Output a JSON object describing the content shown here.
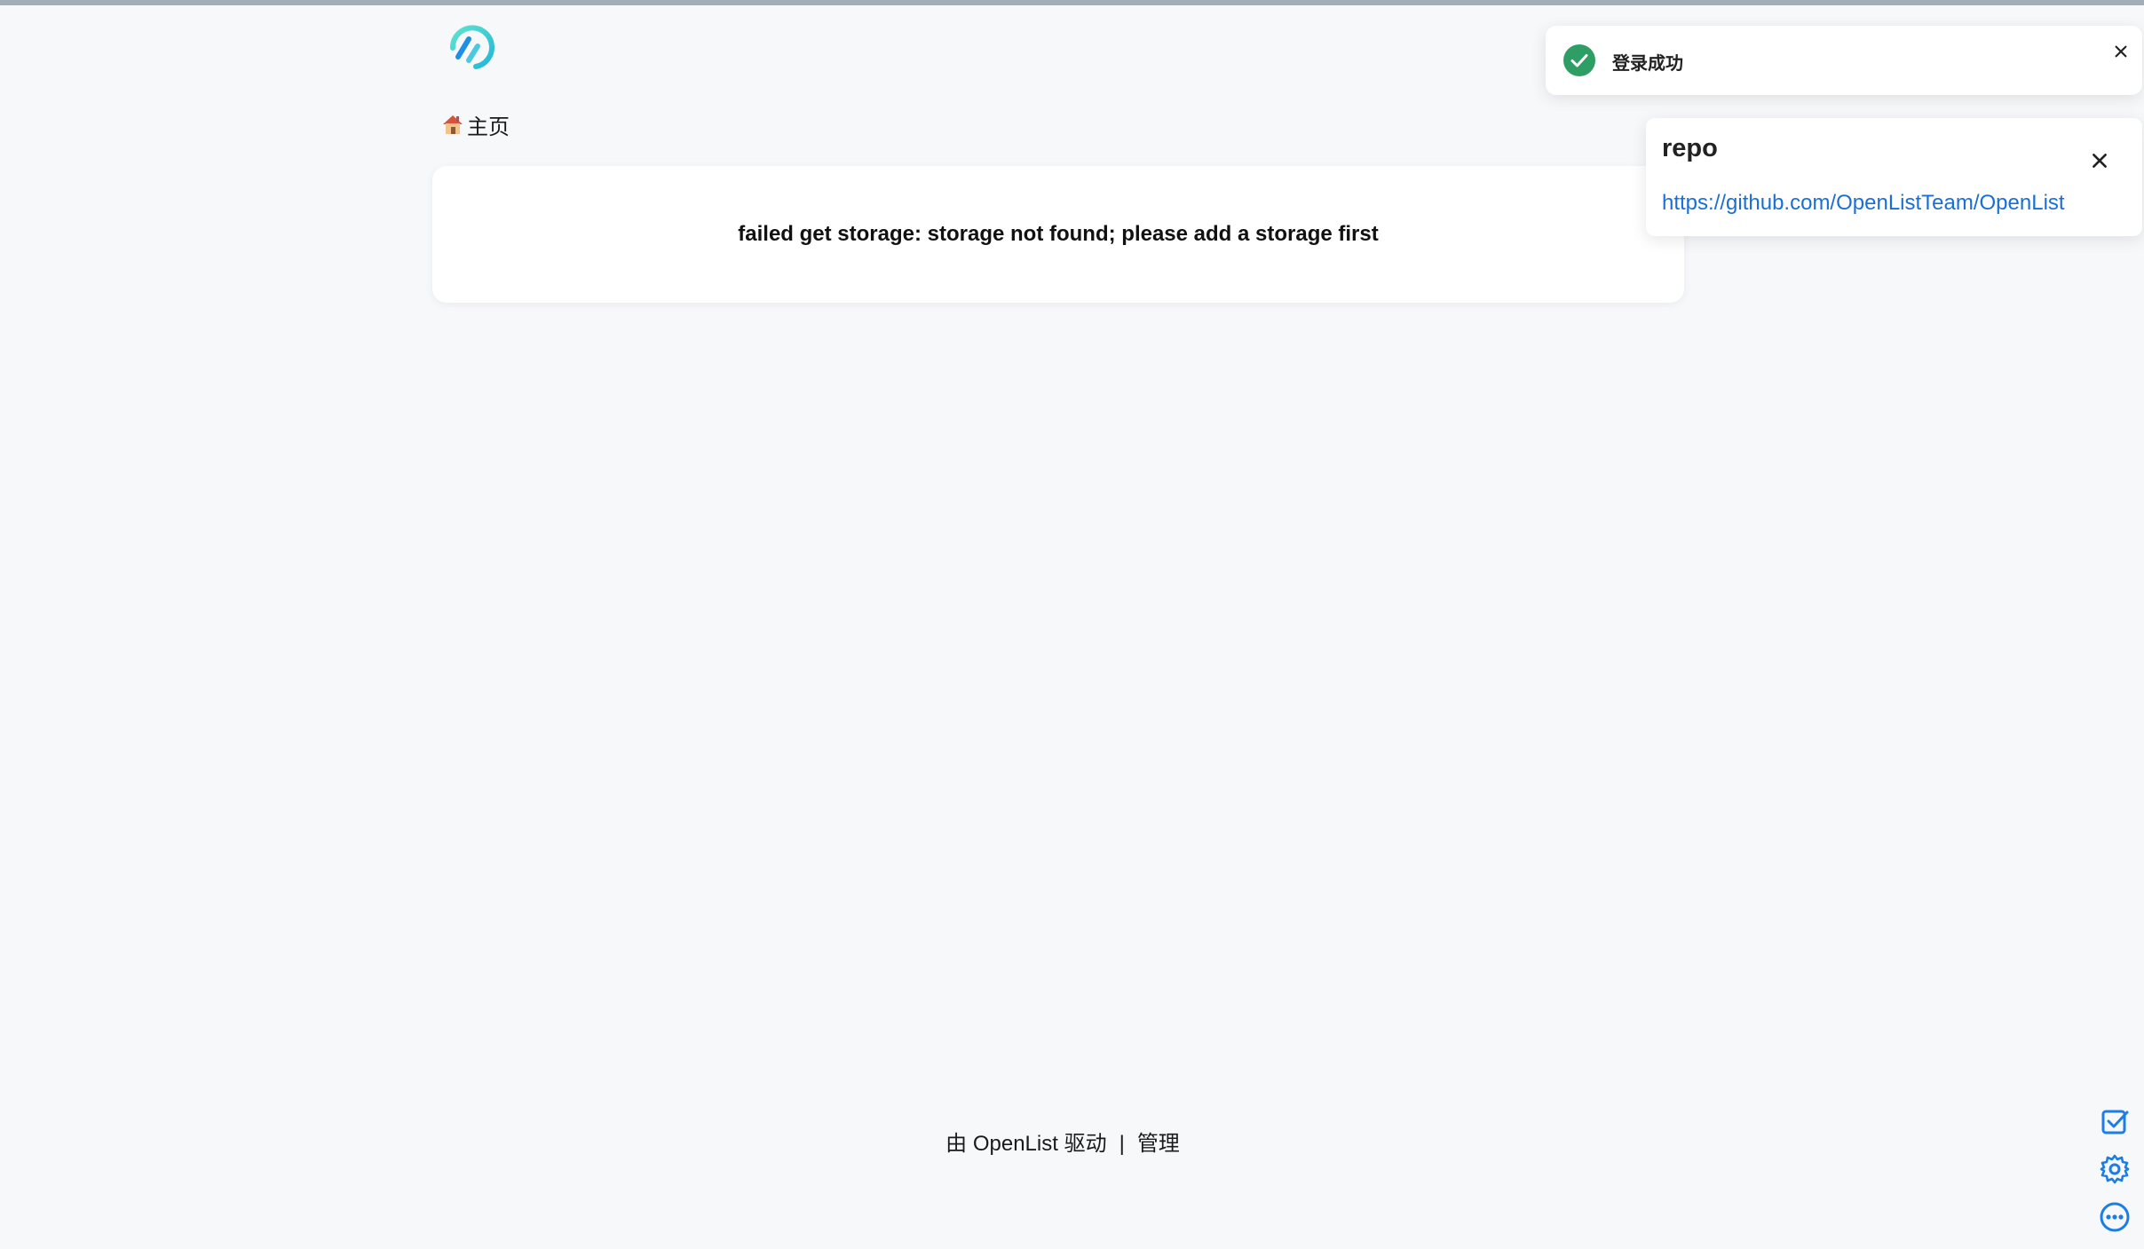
{
  "toast": {
    "message": "登录成功",
    "check_icon": "check-circle-icon",
    "close_icon": "close-icon",
    "accent": "#2f9e65"
  },
  "notice": {
    "title": "repo",
    "link": "https://github.com/OpenListTeam/OpenList",
    "close_icon": "close-icon"
  },
  "header": {
    "logo_icon": "openlist-logo-icon"
  },
  "breadcrumb": {
    "home_icon": "house-icon",
    "home_label": "主页"
  },
  "main": {
    "error_message": "failed get storage: storage not found; please add a storage first"
  },
  "footer": {
    "powered_by": "由 OpenList 驱动",
    "separator": "|",
    "admin_label": "管理"
  },
  "side_tools": [
    {
      "icon": "checkbox-icon"
    },
    {
      "icon": "gear-icon"
    },
    {
      "icon": "more-dots-icon"
    }
  ],
  "colors": {
    "background": "#f7f8fa",
    "link": "#1a6fd6",
    "tool_icon": "#1d7de6"
  }
}
